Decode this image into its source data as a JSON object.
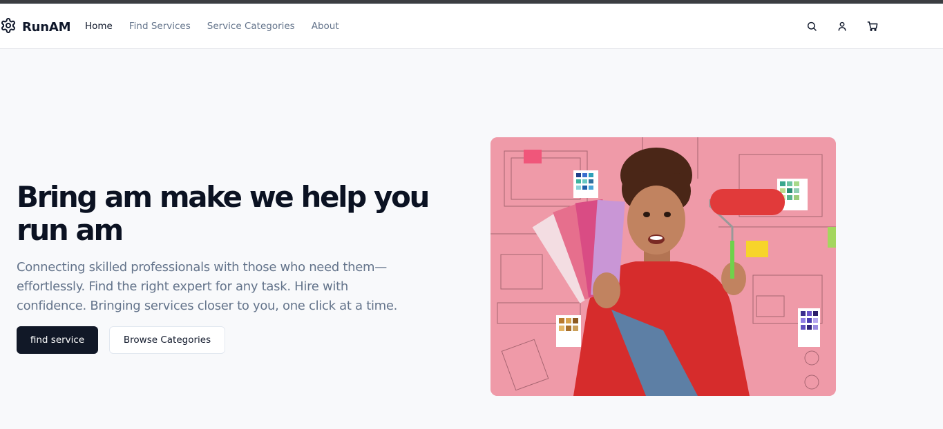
{
  "brand": {
    "name": "RunAM",
    "logo_icon": "gear-icon"
  },
  "nav": {
    "items": [
      {
        "label": "Home",
        "active": true
      },
      {
        "label": "Find Services",
        "active": false
      },
      {
        "label": "Service Categories",
        "active": false
      },
      {
        "label": "About",
        "active": false
      }
    ]
  },
  "header_icons": [
    "search-icon",
    "user-icon",
    "cart-icon"
  ],
  "hero": {
    "title": "Bring am make we help you run am",
    "subtitle": "Connecting skilled professionals with those who need them—effortlessly. Find the right expert for any task. Hire with confidence. Bringing services closer to you, one click at a time.",
    "primary_button": "find service",
    "secondary_button": "Browse Categories"
  },
  "colors": {
    "primary_button_bg": "#111827",
    "background": "#f8f9fb",
    "image_pink": "#ef9aa8",
    "sweater_red": "#d62c2c"
  }
}
